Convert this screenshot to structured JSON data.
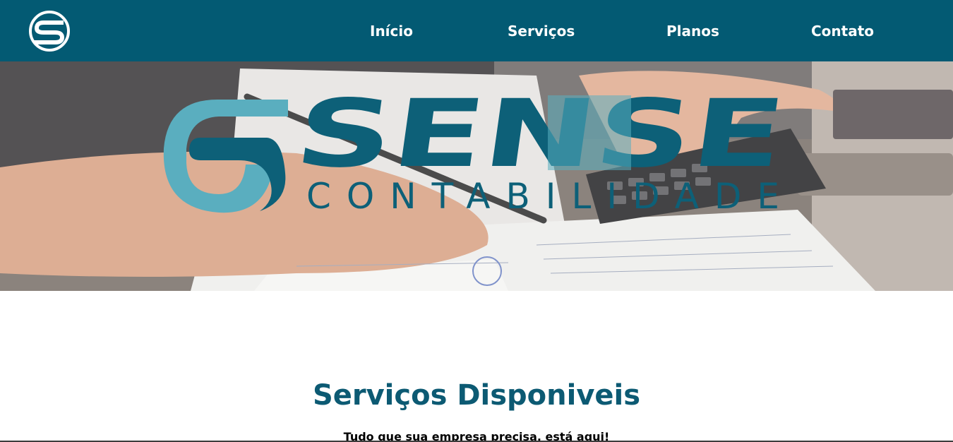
{
  "header": {
    "logo_icon": "s-logo-icon",
    "background": "#035a73",
    "nav": [
      {
        "label": "Início"
      },
      {
        "label": "Serviços"
      },
      {
        "label": "Planos"
      },
      {
        "label": "Contato"
      }
    ]
  },
  "hero": {
    "brand_name": "SENSE",
    "brand_tagline": "CONTABILIDADE",
    "brand_colors": {
      "dark": "#0d6078",
      "light": "#5aaebf"
    },
    "photo": "hands-calculator-documents-photo"
  },
  "services": {
    "title": "Serviços Disponiveis",
    "subtitle": "Tudo que sua empresa precisa, está aqui!"
  }
}
